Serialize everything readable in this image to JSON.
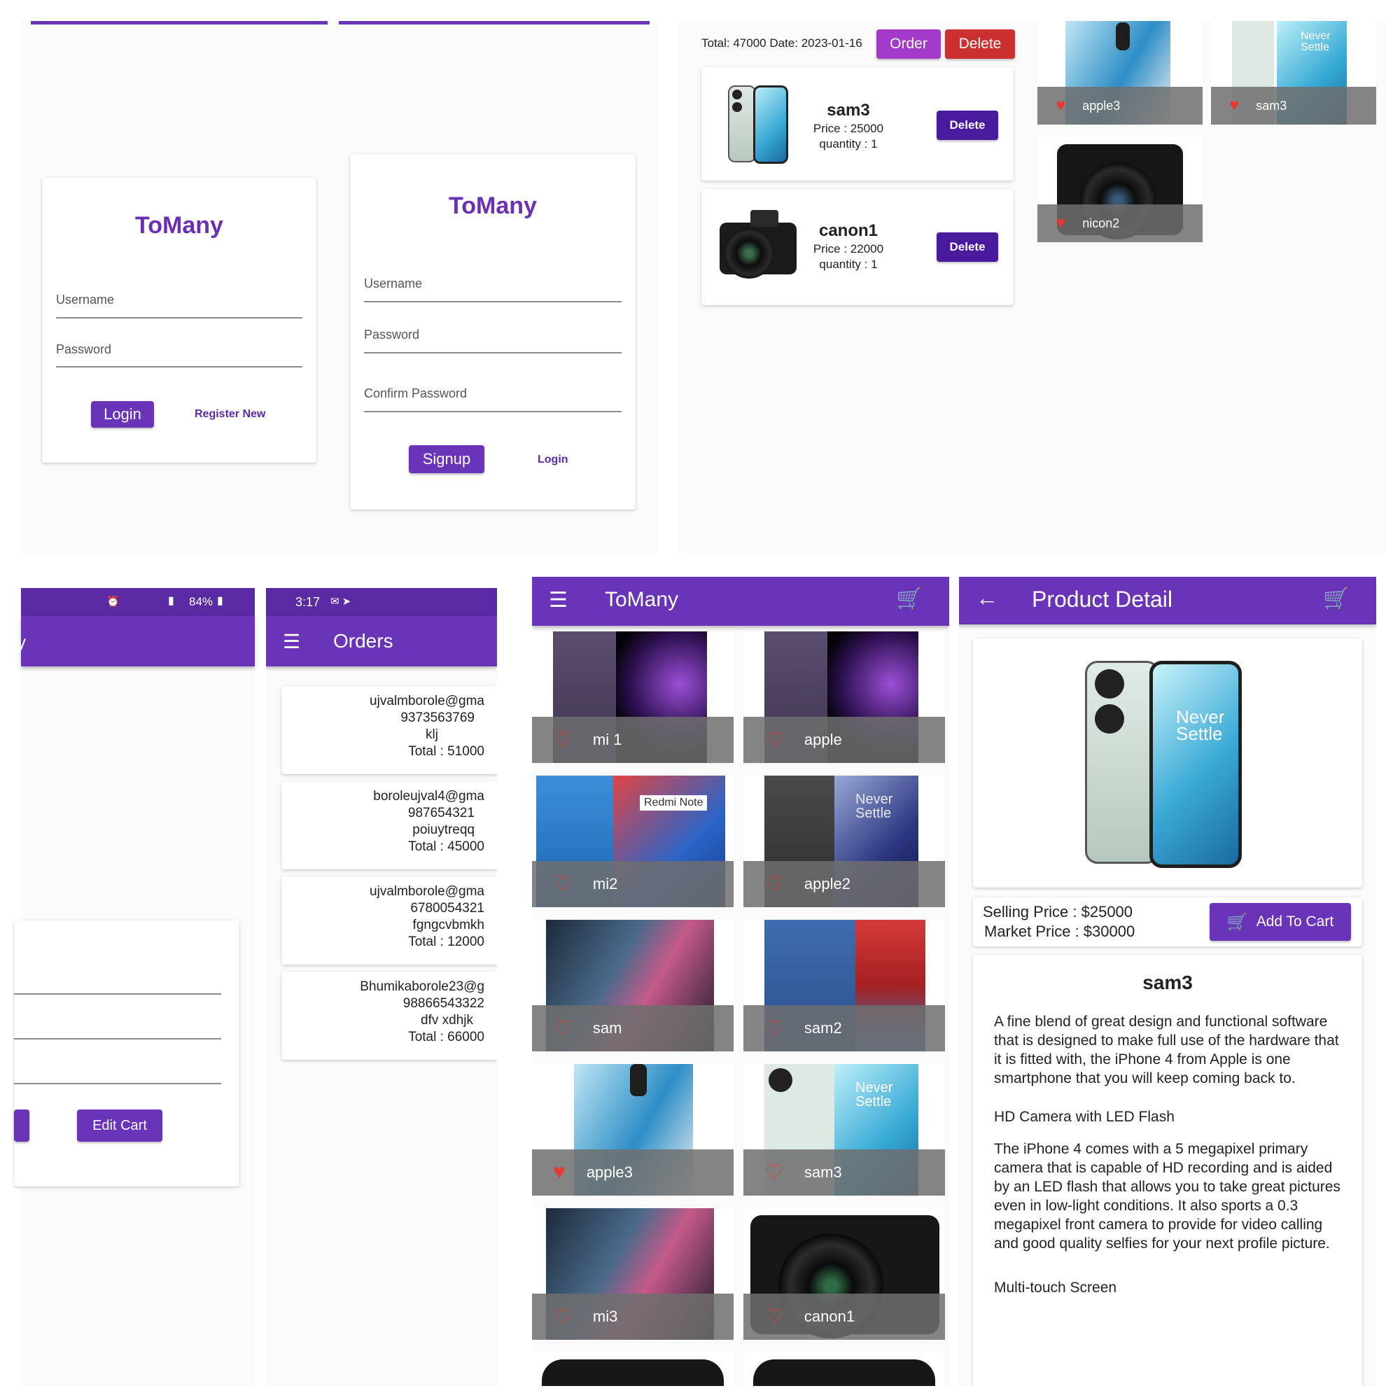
{
  "login_screen": {
    "title": "ToMany",
    "username_label": "Username",
    "password_label": "Password",
    "login_button": "Login",
    "register_link": "Register New"
  },
  "signup_screen": {
    "title": "ToMany",
    "username_label": "Username",
    "password_label": "Password",
    "confirm_label": "Confirm Password",
    "signup_button": "Signup",
    "login_link": "Login"
  },
  "cart_screen": {
    "summary": "Total: 47000 Date: 2023-01-16",
    "order_button": "Order",
    "delete_button": "Delete",
    "items": [
      {
        "name": "sam3",
        "price": "Price : 25000",
        "quantity": "quantity : 1",
        "delete": "Delete"
      },
      {
        "name": "canon1",
        "price": "Price : 22000",
        "quantity": "quantity : 1",
        "delete": "Delete"
      }
    ]
  },
  "favorites_screen": {
    "tiles": [
      {
        "label": "apple3"
      },
      {
        "label": "sam3"
      },
      {
        "label": "nicon2"
      }
    ]
  },
  "status_bar_left": {
    "text": "84%"
  },
  "edit_cart_screen": {
    "appbar_fragment": "y",
    "edit_cart_button": "Edit Cart"
  },
  "orders_screen": {
    "time": "3:17",
    "title": "Orders",
    "orders": [
      {
        "email": "ujvalmborole@gma",
        "phone": "9373563769",
        "note": "klj",
        "total": "Total : 51000"
      },
      {
        "email": "boroleujval4@gma",
        "phone": "987654321",
        "note": "poiuytreqq",
        "total": "Total : 45000"
      },
      {
        "email": "ujvalmborole@gma",
        "phone": "6780054321",
        "note": "fgngcvbmkh",
        "total": "Total : 12000"
      },
      {
        "email": "Bhumikaborole23@g",
        "phone": "98866543322",
        "note": "dfv xdhjk",
        "total": "Total : 66000"
      }
    ]
  },
  "home_screen": {
    "title": "ToMany",
    "products": [
      {
        "label": "mi 1"
      },
      {
        "label": "apple"
      },
      {
        "label": "mi2"
      },
      {
        "label": "apple2"
      },
      {
        "label": "sam"
      },
      {
        "label": "sam2"
      },
      {
        "label": "apple3"
      },
      {
        "label": "sam3"
      },
      {
        "label": "mi3"
      },
      {
        "label": "canon1"
      }
    ],
    "redmi_text": "Redmi Note",
    "never_settle": "Never Settle"
  },
  "detail_screen": {
    "title": "Product Detail",
    "selling_price": "Selling Price :  $25000",
    "market_price": "Market Price : $30000",
    "add_to_cart": "Add To Cart",
    "product_name": "sam3",
    "desc_1": "A fine blend of great design and functional software that is designed to make full use of the hardware that it is fitted with, the iPhone 4 from Apple is one smartphone that you will keep coming back to.",
    "desc_2": "HD Camera with LED Flash",
    "desc_3": "The iPhone 4 comes with a 5 megapixel primary camera that is capable of HD recording and is aided by an LED flash that allows you to take great pictures even in low-light conditions. It also sports a 0.3 megapixel front camera to provide for video calling and good quality selfies for your next profile picture.",
    "desc_4": "Multi-touch Screen",
    "never_settle": "Never Settle"
  },
  "colors": {
    "primary": "#6a34b8",
    "dark_primary": "#4a1a9e",
    "delete_red": "#cb2f2f",
    "heart_red": "#e53935"
  }
}
